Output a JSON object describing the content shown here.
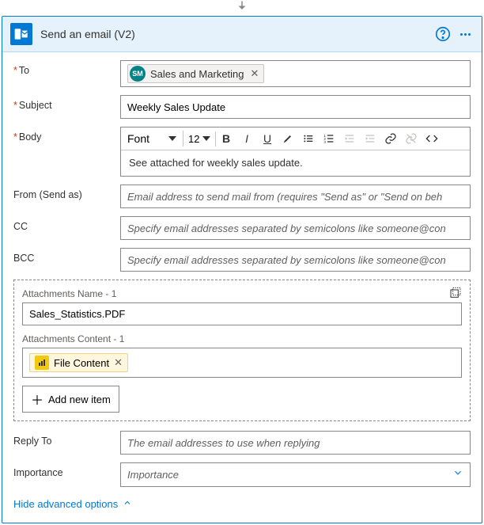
{
  "header": {
    "title": "Send an email (V2)"
  },
  "fields": {
    "to": {
      "label": "To",
      "required": true,
      "token": {
        "initials": "SM",
        "name": "Sales and Marketing"
      }
    },
    "subject": {
      "label": "Subject",
      "required": true,
      "value": "Weekly Sales Update"
    },
    "body": {
      "label": "Body",
      "required": true,
      "font": "Font",
      "size": "12",
      "text": "See attached for weekly sales update."
    },
    "from": {
      "label": "From (Send as)",
      "placeholder": "Email address to send mail from (requires \"Send as\" or \"Send on beh"
    },
    "cc": {
      "label": "CC",
      "placeholder": "Specify email addresses separated by semicolons like someone@con"
    },
    "bcc": {
      "label": "BCC",
      "placeholder": "Specify email addresses separated by semicolons like someone@con"
    },
    "replyTo": {
      "label": "Reply To",
      "placeholder": "The email addresses to use when replying"
    },
    "importance": {
      "label": "Importance",
      "placeholder": "Importance"
    }
  },
  "attachments": {
    "nameLabel": "Attachments Name - 1",
    "nameValue": "Sales_Statistics.PDF",
    "contentLabel": "Attachments Content - 1",
    "contentToken": "File Content",
    "addItem": "Add new item"
  },
  "footer": {
    "hideAdvanced": "Hide advanced options"
  }
}
